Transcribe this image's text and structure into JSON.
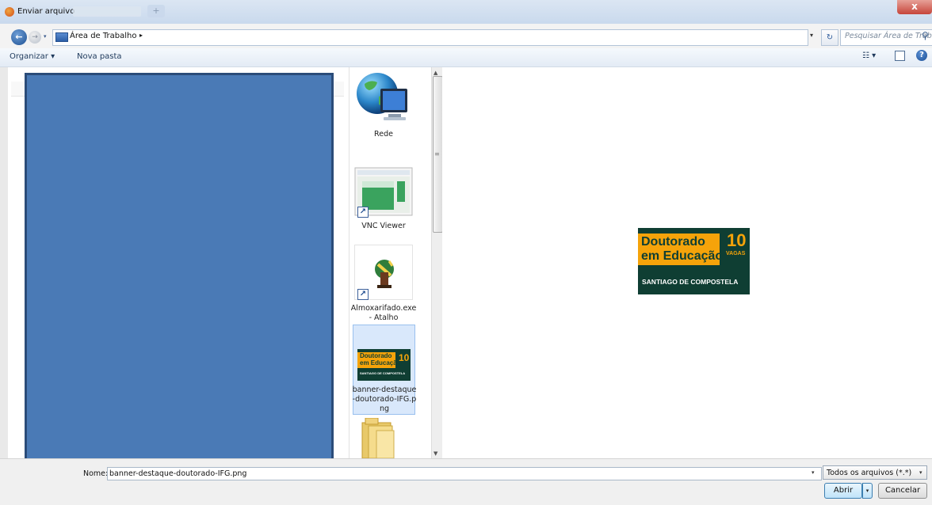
{
  "window": {
    "title": "Enviar arquivo",
    "close_label": "x",
    "new_tab_label": "+"
  },
  "address": {
    "location": "Área de Trabalho",
    "separator": "▸",
    "search_placeholder": "Pesquisar Área de Trab...",
    "refresh_glyph": "↻",
    "dropdown_glyph": "▾",
    "search_glyph": "⚲",
    "back_glyph": "←",
    "forward_glyph": "→"
  },
  "toolbar": {
    "organize_label": "Organizar ▾",
    "new_folder_label": "Nova pasta",
    "views_glyph": "☷ ▾",
    "help_glyph": "?"
  },
  "files": [
    {
      "name": "Rede",
      "icon": "network-globe-icon",
      "selected": false
    },
    {
      "name": "VNC Viewer",
      "icon": "vnc-viewer-icon",
      "shortcut": true,
      "selected": false
    },
    {
      "name": "Almoxarifado.exe - Atalho",
      "icon": "application-icon",
      "shortcut": true,
      "selected": false
    },
    {
      "name": "banner-destaque-doutorado-IFG.png",
      "icon": "image-thumbnail-icon",
      "selected": true
    },
    {
      "name": "",
      "icon": "folder-icon",
      "selected": false
    }
  ],
  "file_labels": {
    "rede": "Rede",
    "vnc": "VNC Viewer",
    "almox_line1": "Almoxarifado.exe",
    "almox_line2": "- Atalho",
    "banner_line1": "banner-destaque",
    "banner_line2": "-doutorado-IFG.p",
    "banner_line3": "ng"
  },
  "preview": {
    "line1": "Doutorado",
    "line2": "em Educação",
    "number": "10",
    "vagas": "VAGAS",
    "subtitle": "SANTIAGO DE COMPOSTELA"
  },
  "footer": {
    "name_label": "Nome:",
    "name_value": "banner-destaque-doutorado-IFG.png",
    "filter_value": "Todos os arquivos (*.*)",
    "open_label": "Abrir",
    "cancel_label": "Cancelar"
  },
  "scrollbar": {
    "up_glyph": "▲",
    "down_glyph": "▼",
    "grip_glyph": "≡"
  },
  "colors": {
    "banner_green": "#0f3e33",
    "banner_orange": "#f5a30a",
    "redaction_blue": "#4a7ab6",
    "selection": "#d9e8fb"
  }
}
